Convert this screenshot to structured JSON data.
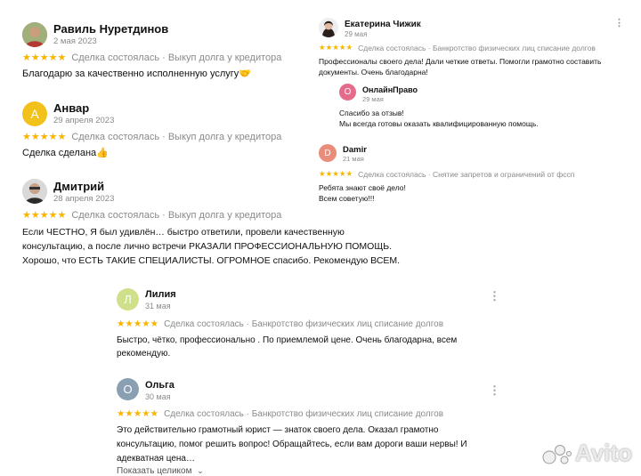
{
  "reviews_left": [
    {
      "name": "Равиль Нуретдинов",
      "date": "2 мая 2023",
      "stars": "★★★★★",
      "meta": "Сделка состоялась · Выкуп долга у кредитора",
      "lines": [
        "Благодарю за качественно исполненную услугу🤝"
      ]
    },
    {
      "name": "Анвар",
      "initial": "А",
      "date": "29 апреля 2023",
      "stars": "★★★★★",
      "meta": "Сделка состоялась · Выкуп долга у кредитора",
      "lines": [
        "Сделка сделана👍"
      ]
    },
    {
      "name": "Дмитрий",
      "date": "28 апреля 2023",
      "stars": "★★★★★",
      "meta": "Сделка состоялась · Выкуп долга у кредитора",
      "lines": [
        "Если ЧЕСТНО, Я был удивлён… быстро ответили, провели качественную",
        "консультацию, а после лично встречи РКАЗАЛИ ПРОФЕССИОНАЛЬНУЮ ПОМОЩЬ.",
        "Хорошо, что ЕСТЬ ТАКИЕ СПЕЦИАЛИСТЫ. ОГРОМНОЕ спасибо. Рекомендую ВСЕМ."
      ]
    }
  ],
  "reviews_right": [
    {
      "name": "Екатерина Чижик",
      "date": "29 мая",
      "stars": "★★★★★",
      "meta": "Сделка состоялась · Банкротство физических лиц списание долгов",
      "lines": [
        "Профессионалы своего дела! Дали четкие ответы. Помогли грамотно составить",
        "документы. Очень благодарна!"
      ],
      "reply": {
        "name": "ОнлайнПраво",
        "initial": "О",
        "date": "29 мая",
        "lines": [
          "Спасибо за отзыв!",
          "Мы всегда готовы оказать квалифицированную помощь."
        ]
      }
    },
    {
      "name": "Damir",
      "initial": "D",
      "date": "21 мая",
      "stars": "★★★★★",
      "meta": "Сделка состоялась · Снятие запретов и ограничений от фссп",
      "lines": [
        "Ребята знают своё дело!",
        "Всем советую!!!"
      ]
    }
  ],
  "reviews_bottom": [
    {
      "name": "Лилия",
      "initial": "Л",
      "date": "31 мая",
      "stars": "★★★★★",
      "meta": "Сделка состоялась · Банкротство физических лиц списание долгов",
      "lines": [
        "Быстро, чётко, профессионально . По приемлемой цене. Очень благодарна, всем",
        "рекомендую."
      ]
    },
    {
      "name": "Ольга",
      "initial": "О",
      "date": "30 мая",
      "stars": "★★★★★",
      "meta": "Сделка состоялась · Банкротство физических лиц списание долгов",
      "lines": [
        "Это действительно грамотный юрист — знаток своего дела. Оказал грамотно",
        "консультацию, помог решить вопрос! Обращайтесь, если вам дороги ваши нервы! И",
        "адекватная цена…"
      ],
      "more": "Показать целиком"
    }
  ],
  "watermark": "Avito",
  "colors": {
    "star": "#f7b500",
    "avatar_anvar": "#f2c21b",
    "avatar_online": "#e56b8a",
    "avatar_damir": "#e98d7a",
    "avatar_liliya": "#cfe08a",
    "avatar_olga": "#8aa0b2"
  }
}
